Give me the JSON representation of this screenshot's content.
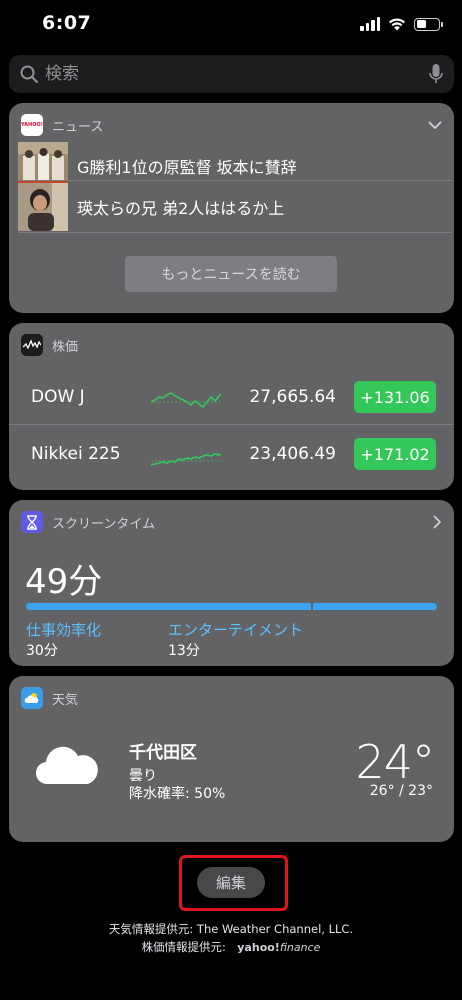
{
  "status_bar": {
    "time": "6:07"
  },
  "search": {
    "placeholder": "検索"
  },
  "news": {
    "title": "ニュース",
    "app_icon_text": "YAHOO!",
    "items": [
      {
        "headline": "G勝利1位の原監督 坂本に賛辞"
      },
      {
        "headline": "瑛太らの兄 弟2人ははるか上"
      }
    ],
    "more_label": "もっとニュースを読む"
  },
  "stocks": {
    "title": "株価",
    "rows": [
      {
        "symbol": "DOW J",
        "price": "27,665.64",
        "change": "+131.06"
      },
      {
        "symbol": "Nikkei 225",
        "price": "23,406.49",
        "change": "+171.02"
      }
    ],
    "colors": {
      "up": "#34c759"
    }
  },
  "screen_time": {
    "title": "スクリーンタイム",
    "total": "49分",
    "categories": [
      {
        "name": "仕事効率化",
        "time": "30分",
        "minutes": 30
      },
      {
        "name": "エンターテイメント",
        "time": "13分",
        "minutes": 13
      }
    ],
    "colors": {
      "bar": "#3aa4f0",
      "label": "#5ac0ff"
    }
  },
  "weather": {
    "title": "天気",
    "location": "千代田区",
    "condition": "曇り",
    "precipitation": "降水確率: 50%",
    "temperature": "24°",
    "range": "26° / 23°",
    "icon": "cloud-icon"
  },
  "edit": {
    "label": "編集",
    "highlight_color": "#e0161e"
  },
  "credits": {
    "weather": "天気情報提供元: The Weather Channel, LLC.",
    "finance_prefix": "株価情報提供元:",
    "finance_logo_a": "yahoo!",
    "finance_logo_b": "finance"
  }
}
